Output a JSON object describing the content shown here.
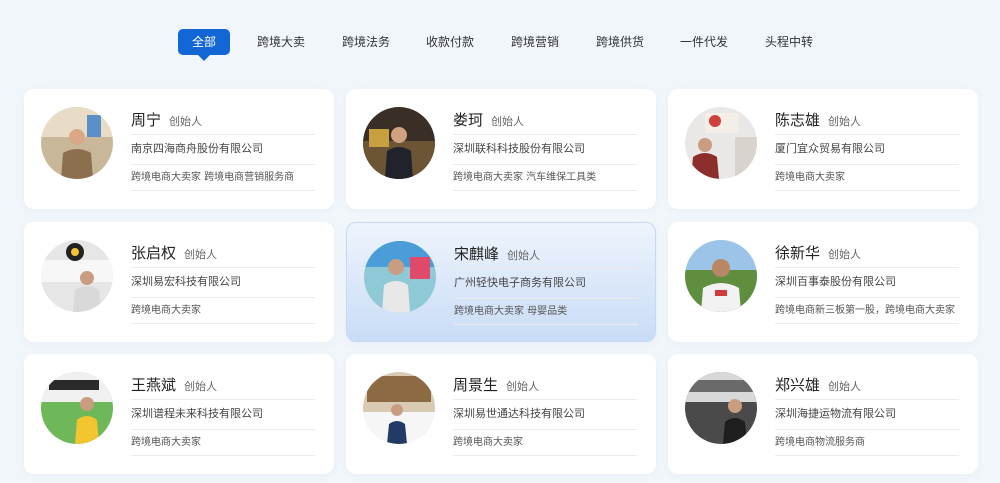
{
  "tabs": [
    {
      "label": "全部",
      "active": true
    },
    {
      "label": "跨境大卖",
      "active": false
    },
    {
      "label": "跨境法务",
      "active": false
    },
    {
      "label": "收款付款",
      "active": false
    },
    {
      "label": "跨境营销",
      "active": false
    },
    {
      "label": "跨境供货",
      "active": false
    },
    {
      "label": "一件代发",
      "active": false
    },
    {
      "label": "头程中转",
      "active": false
    }
  ],
  "accent_color": "#1366d6",
  "cards": [
    {
      "name": "周宁",
      "role": "创始人",
      "company": "南京四海商舟股份有限公司",
      "tags": "跨境电商大卖家 跨境电商营销服务商"
    },
    {
      "name": "娄珂",
      "role": "创始人",
      "company": "深圳联科科技股份有限公司",
      "tags": "跨境电商大卖家 汽车维保工具类"
    },
    {
      "name": "陈志雄",
      "role": "创始人",
      "company": "厦门宜众贸易有限公司",
      "tags": "跨境电商大卖家"
    },
    {
      "name": "张启权",
      "role": "创始人",
      "company": "深圳易宏科技有限公司",
      "tags": "跨境电商大卖家"
    },
    {
      "name": "宋麒峰",
      "role": "创始人",
      "company": "广州轻快电子商务有限公司",
      "tags": "跨境电商大卖家 母婴品类"
    },
    {
      "name": "徐新华",
      "role": "创始人",
      "company": "深圳百事泰股份有限公司",
      "tags": "跨境电商新三板第一股，跨境电商大卖家"
    },
    {
      "name": "王燕斌",
      "role": "创始人",
      "company": "深圳谱程未来科技有限公司",
      "tags": "跨境电商大卖家"
    },
    {
      "name": "周景生",
      "role": "创始人",
      "company": "深圳易世通达科技有限公司",
      "tags": "跨境电商大卖家"
    },
    {
      "name": "郑兴雄",
      "role": "创始人",
      "company": "深圳海捷运物流有限公司",
      "tags": "跨境电商物流服务商"
    }
  ]
}
